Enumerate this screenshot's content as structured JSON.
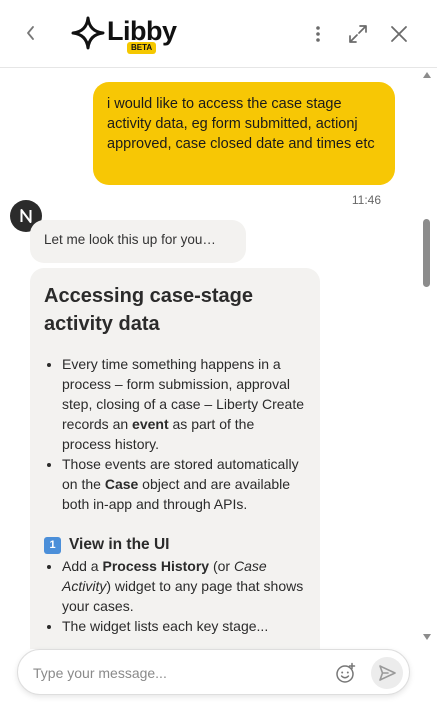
{
  "header": {
    "logo_text": "Libby",
    "badge": "BETA",
    "icons": {
      "back": "chevron-left-icon",
      "more": "more-vertical-icon",
      "expand": "expand-icon",
      "close": "close-icon"
    }
  },
  "messages": {
    "user": {
      "text": "i would like to access the case stage activity data, eg form submitted, actionj approved, case closed date and times etc",
      "time": "11:46"
    },
    "bot_intro": "Let me look this up for you…",
    "bot_card": {
      "title": "Accessing case-stage activity data",
      "bullets": [
        [
          {
            "t": "Every time something happens in a process – form submission, approval step, closing of a case – Liberty Create records an "
          },
          {
            "t": "event",
            "b": true
          },
          {
            "t": " as part of the process history."
          }
        ],
        [
          {
            "t": "Those events are stored automatically on the "
          },
          {
            "t": "Case",
            "b": true
          },
          {
            "t": " object and are available both in-app and through APIs."
          }
        ]
      ],
      "section1": {
        "number": "1",
        "title": "View in the UI"
      },
      "section1_bullets": [
        [
          {
            "t": "Add a "
          },
          {
            "t": "Process History",
            "b": true
          },
          {
            "t": " (or "
          },
          {
            "t": "Case Activity",
            "i": true
          },
          {
            "t": ") widget to any page that shows your cases."
          }
        ],
        [
          {
            "t": "The widget lists each key stage..."
          }
        ]
      ]
    }
  },
  "composer": {
    "placeholder": "Type your message...",
    "icons": {
      "emoji": "emoji-add-icon",
      "send": "send-icon"
    }
  },
  "colors": {
    "accent": "#f7c705",
    "bot_bubble": "#f3f2f0",
    "avatar": "#2b2b2b",
    "number_badge": "#4b8fd9"
  }
}
